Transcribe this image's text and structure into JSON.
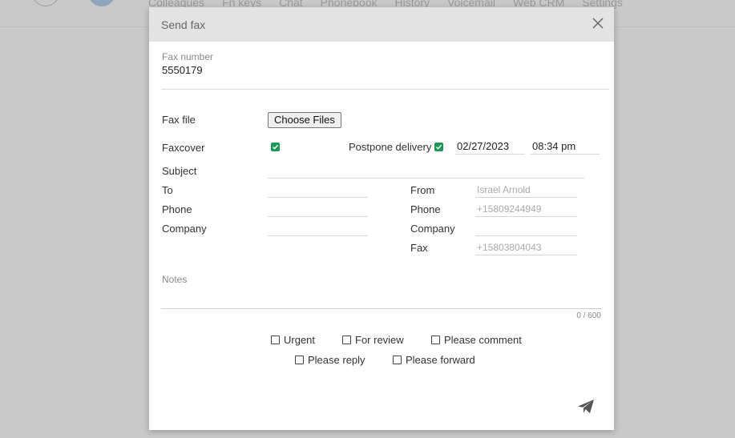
{
  "background": {
    "nav": [
      "Colleagues",
      "Fn keys",
      "Chat",
      "Phonebook",
      "History",
      "Voicemail",
      "Web CRM",
      "Settings"
    ]
  },
  "dialog": {
    "title": "Send fax",
    "fax_number_label": "Fax number",
    "fax_number_value": "5550179",
    "fax_file_label": "Fax file",
    "choose_files_label": "Choose Files",
    "faxcover_label": "Faxcover",
    "postpone_label": "Postpone delivery",
    "postpone_date": "02/27/2023",
    "postpone_time": "08:34 pm",
    "subject_label": "Subject",
    "to_label": "To",
    "phone_label": "Phone",
    "company_label": "Company",
    "from_label": "From",
    "from_phone_label": "Phone",
    "from_company_label": "Company",
    "from_fax_label": "Fax",
    "from_value": "Israel Arnold",
    "from_phone_value": "+15809244949",
    "from_company_value": "",
    "from_fax_value": "+15803804043",
    "notes_label": "Notes",
    "notes_counter": "0 / 600",
    "options": {
      "urgent": "Urgent",
      "for_review": "For review",
      "please_comment": "Please comment",
      "please_reply": "Please reply",
      "please_forward": "Please forward"
    }
  },
  "colors": {
    "accent_green": "#1a9a55",
    "header_bg": "#e3e3e3"
  },
  "icons": {
    "close": "close-icon",
    "send": "paper-plane-icon",
    "check": "checkmark-icon"
  }
}
